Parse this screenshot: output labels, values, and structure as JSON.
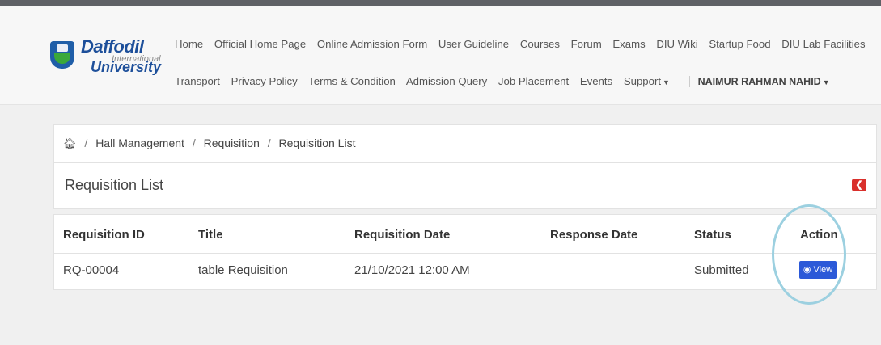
{
  "brand": {
    "line1": "Daffodil",
    "line2": "International",
    "line3": "University"
  },
  "nav": {
    "row1": [
      "Home",
      "Official Home Page",
      "Online Admission Form",
      "User Guideline",
      "Courses",
      "Forum",
      "Exams",
      "DIU Wiki",
      "Startup Food",
      "DIU Lab Facilities"
    ],
    "row2": [
      "Transport",
      "Privacy Policy",
      "Terms & Condition",
      "Admission Query",
      "Job Placement",
      "Events"
    ],
    "support": "Support",
    "user": "NAIMUR RAHMAN NAHID"
  },
  "breadcrumb": {
    "items": [
      "Hall Management",
      "Requisition",
      "Requisition List"
    ]
  },
  "page_title": "Requisition List",
  "table": {
    "columns": [
      "Requisition ID",
      "Title",
      "Requisition Date",
      "Response Date",
      "Status",
      "Action"
    ],
    "rows": [
      {
        "id": "RQ-00004",
        "title": "table Requisition",
        "req_date": "21/10/2021 12:00 AM",
        "resp_date": "",
        "status": "Submitted",
        "action": "View"
      }
    ]
  },
  "colors": {
    "view_button": "#2b59d8",
    "exit_button": "#d9302c",
    "highlight_circle": "#9cd0e0"
  }
}
